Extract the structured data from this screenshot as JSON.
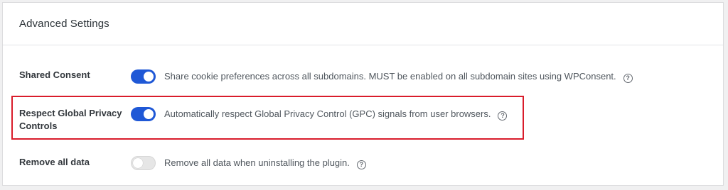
{
  "panel": {
    "title": "Advanced Settings"
  },
  "settings": [
    {
      "label": "Shared Consent",
      "enabled": true,
      "description": "Share cookie preferences across all subdomains. MUST be enabled on all subdomain sites using WPConsent.",
      "help_icon": "question-circle-icon"
    },
    {
      "label": "Respect Global Privacy Controls",
      "enabled": true,
      "description": "Automatically respect Global Privacy Control (GPC) signals from user browsers.",
      "help_icon": "question-circle-icon"
    },
    {
      "label": "Remove all data",
      "enabled": false,
      "description": "Remove all data when uninstalling the plugin.",
      "help_icon": "question-circle-icon"
    }
  ],
  "colors": {
    "toggle_on": "#1f58d6",
    "toggle_off": "#e6e6e6",
    "highlight_border": "#d91c2b"
  },
  "help_icon_glyph": "?"
}
